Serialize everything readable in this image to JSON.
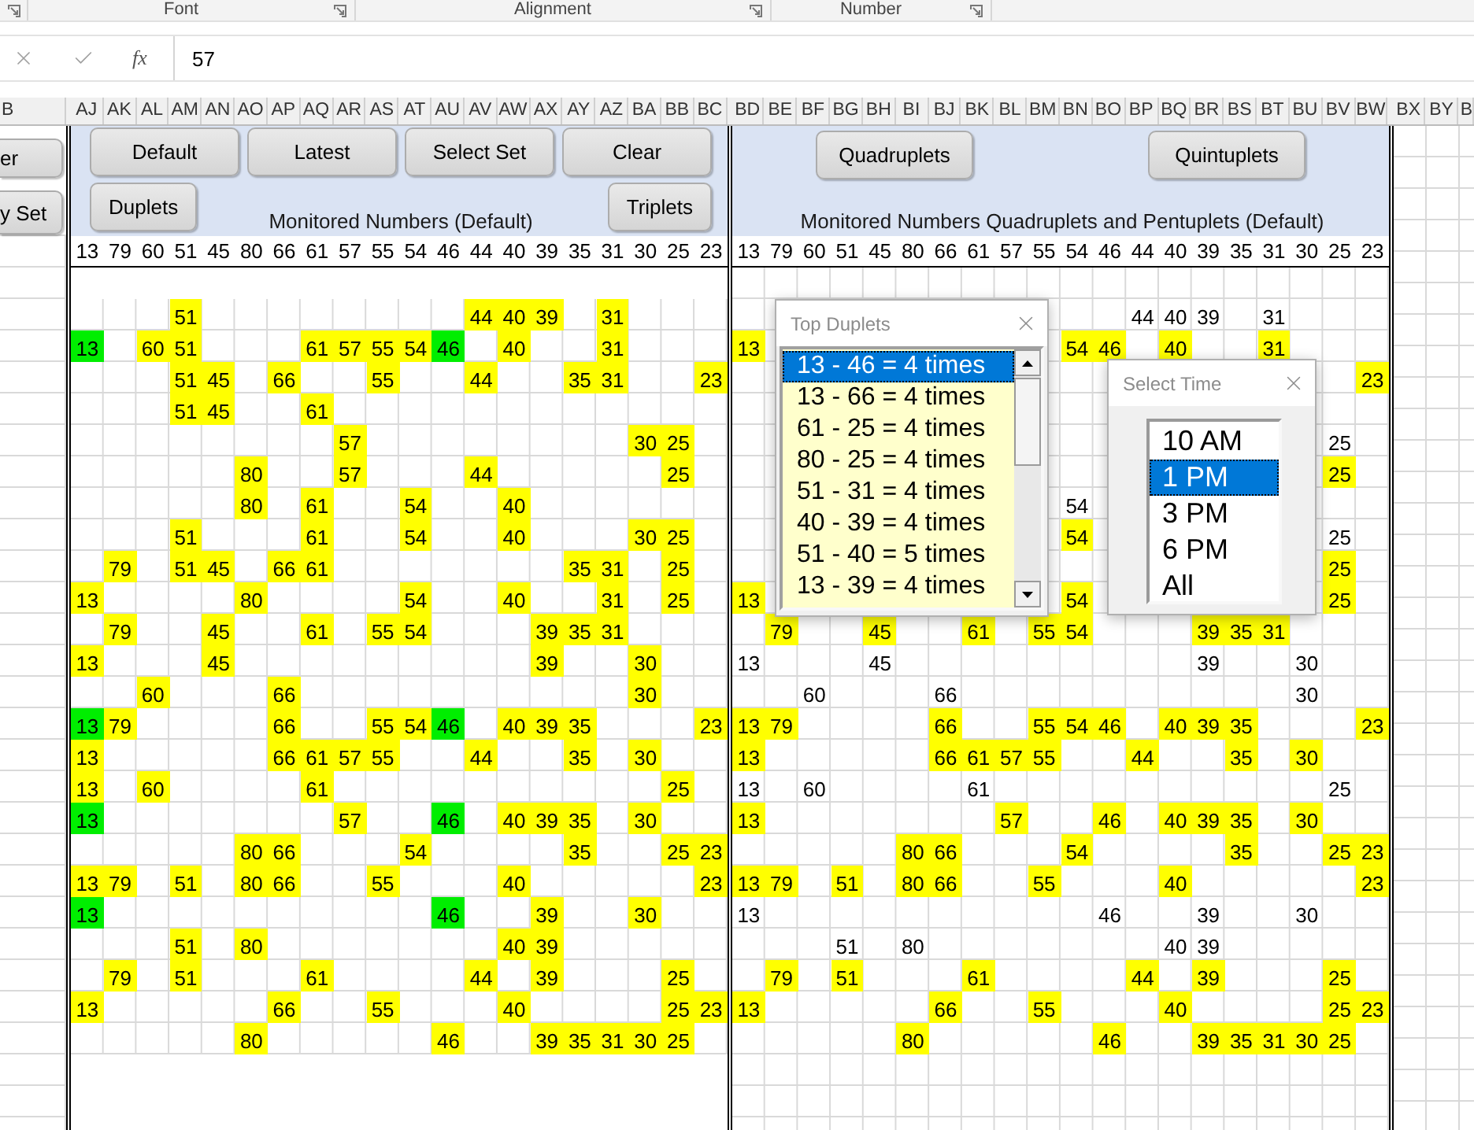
{
  "ribbon_groups": [
    {
      "label": "Font"
    },
    {
      "label": "Alignment"
    },
    {
      "label": "Number"
    }
  ],
  "formula_bar": {
    "function_label": "fx",
    "value": "57"
  },
  "column_headers": {
    "leading": "B",
    "panels": [
      [
        "AJ",
        "AK",
        "AL",
        "AM",
        "AN",
        "AO",
        "AP",
        "AQ",
        "AR",
        "AS",
        "AT",
        "AU",
        "AV",
        "AW",
        "AX",
        "AY",
        "AZ",
        "BA",
        "BB",
        "BC"
      ],
      [
        "BD",
        "BE",
        "BF",
        "BG",
        "BH",
        "BI",
        "BJ",
        "BK",
        "BL",
        "BM",
        "BN",
        "BO",
        "BP",
        "BQ",
        "BR",
        "BS",
        "BT",
        "BU",
        "BV",
        "BW"
      ]
    ],
    "trailing": [
      "BX",
      "BY",
      "B"
    ]
  },
  "side_buttons": [
    "er",
    "y Set"
  ],
  "panels": [
    {
      "top_buttons": [
        "Default",
        "Latest",
        "Select Set",
        "Clear"
      ],
      "bottom_left_buttons": [
        "Duplets"
      ],
      "bottom_right_buttons": [
        "Triplets"
      ],
      "title": "Monitored Numbers (Default)",
      "numbers": [
        "13",
        "79",
        "60",
        "51",
        "45",
        "80",
        "66",
        "61",
        "57",
        "55",
        "54",
        "46",
        "44",
        "40",
        "39",
        "35",
        "31",
        "30",
        "25",
        "23"
      ],
      "rows": [
        [
          null,
          null,
          null,
          {
            "text": "51",
            "color": "#ffff00"
          },
          null,
          null,
          null,
          null,
          null,
          null,
          null,
          null,
          {
            "text": "44",
            "color": "#ffff00"
          },
          {
            "text": "40",
            "color": "#ffff00"
          },
          {
            "text": "39",
            "color": "#ffff00"
          },
          null,
          {
            "text": "31",
            "color": "#ffff00"
          },
          null,
          null,
          null
        ],
        [
          {
            "text": "13",
            "color": "#00ee00"
          },
          null,
          {
            "text": "60",
            "color": "#ffff00"
          },
          {
            "text": "51",
            "color": "#ffff00"
          },
          null,
          null,
          null,
          {
            "text": "61",
            "color": "#ffff00"
          },
          {
            "text": "57",
            "color": "#ffff00"
          },
          {
            "text": "55",
            "color": "#ffff00"
          },
          {
            "text": "54",
            "color": "#ffff00"
          },
          {
            "text": "46",
            "color": "#00ee00"
          },
          null,
          {
            "text": "40",
            "color": "#ffff00"
          },
          null,
          null,
          {
            "text": "31",
            "color": "#ffff00"
          },
          null,
          null,
          null
        ],
        [
          null,
          null,
          null,
          {
            "text": "51",
            "color": "#ffff00"
          },
          {
            "text": "45",
            "color": "#ffff00"
          },
          null,
          {
            "text": "66",
            "color": "#ffff00"
          },
          null,
          null,
          {
            "text": "55",
            "color": "#ffff00"
          },
          null,
          null,
          {
            "text": "44",
            "color": "#ffff00"
          },
          null,
          null,
          {
            "text": "35",
            "color": "#ffff00"
          },
          {
            "text": "31",
            "color": "#ffff00"
          },
          null,
          null,
          {
            "text": "23",
            "color": "#ffff00"
          }
        ],
        [
          null,
          null,
          null,
          {
            "text": "51",
            "color": "#ffff00"
          },
          {
            "text": "45",
            "color": "#ffff00"
          },
          null,
          null,
          {
            "text": "61",
            "color": "#ffff00"
          },
          null,
          null,
          null,
          null,
          null,
          null,
          null,
          null,
          null,
          null,
          null,
          null
        ],
        [
          null,
          null,
          null,
          null,
          null,
          null,
          null,
          null,
          {
            "text": "57",
            "color": "#ffff00"
          },
          null,
          null,
          null,
          null,
          null,
          null,
          null,
          null,
          {
            "text": "30",
            "color": "#ffff00"
          },
          {
            "text": "25",
            "color": "#ffff00"
          },
          null
        ],
        [
          null,
          null,
          null,
          null,
          null,
          {
            "text": "80",
            "color": "#ffff00"
          },
          null,
          null,
          {
            "text": "57",
            "color": "#ffff00"
          },
          null,
          null,
          null,
          {
            "text": "44",
            "color": "#ffff00"
          },
          null,
          null,
          null,
          null,
          null,
          {
            "text": "25",
            "color": "#ffff00"
          },
          null
        ],
        [
          null,
          null,
          null,
          null,
          null,
          {
            "text": "80",
            "color": "#ffff00"
          },
          null,
          {
            "text": "61",
            "color": "#ffff00"
          },
          null,
          null,
          {
            "text": "54",
            "color": "#ffff00"
          },
          null,
          null,
          {
            "text": "40",
            "color": "#ffff00"
          },
          null,
          null,
          null,
          null,
          null,
          null
        ],
        [
          null,
          null,
          null,
          {
            "text": "51",
            "color": "#ffff00"
          },
          null,
          null,
          null,
          {
            "text": "61",
            "color": "#ffff00"
          },
          null,
          null,
          {
            "text": "54",
            "color": "#ffff00"
          },
          null,
          null,
          {
            "text": "40",
            "color": "#ffff00"
          },
          null,
          null,
          null,
          {
            "text": "30",
            "color": "#ffff00"
          },
          {
            "text": "25",
            "color": "#ffff00"
          },
          null
        ],
        [
          null,
          {
            "text": "79",
            "color": "#ffff00"
          },
          null,
          {
            "text": "51",
            "color": "#ffff00"
          },
          {
            "text": "45",
            "color": "#ffff00"
          },
          null,
          {
            "text": "66",
            "color": "#ffff00"
          },
          {
            "text": "61",
            "color": "#ffff00"
          },
          null,
          null,
          null,
          null,
          null,
          null,
          null,
          {
            "text": "35",
            "color": "#ffff00"
          },
          {
            "text": "31",
            "color": "#ffff00"
          },
          null,
          {
            "text": "25",
            "color": "#ffff00"
          },
          null
        ],
        [
          {
            "text": "13",
            "color": "#ffff00"
          },
          null,
          null,
          null,
          null,
          {
            "text": "80",
            "color": "#ffff00"
          },
          null,
          null,
          null,
          null,
          {
            "text": "54",
            "color": "#ffff00"
          },
          null,
          null,
          {
            "text": "40",
            "color": "#ffff00"
          },
          null,
          null,
          {
            "text": "31",
            "color": "#ffff00"
          },
          null,
          {
            "text": "25",
            "color": "#ffff00"
          },
          null
        ],
        [
          null,
          {
            "text": "79",
            "color": "#ffff00"
          },
          null,
          null,
          {
            "text": "45",
            "color": "#ffff00"
          },
          null,
          null,
          {
            "text": "61",
            "color": "#ffff00"
          },
          null,
          {
            "text": "55",
            "color": "#ffff00"
          },
          {
            "text": "54",
            "color": "#ffff00"
          },
          null,
          null,
          null,
          {
            "text": "39",
            "color": "#ffff00"
          },
          {
            "text": "35",
            "color": "#ffff00"
          },
          {
            "text": "31",
            "color": "#ffff00"
          },
          null,
          null,
          null
        ],
        [
          {
            "text": "13",
            "color": "#ffff00"
          },
          null,
          null,
          null,
          {
            "text": "45",
            "color": "#ffff00"
          },
          null,
          null,
          null,
          null,
          null,
          null,
          null,
          null,
          null,
          {
            "text": "39",
            "color": "#ffff00"
          },
          null,
          null,
          {
            "text": "30",
            "color": "#ffff00"
          },
          null,
          null
        ],
        [
          null,
          null,
          {
            "text": "60",
            "color": "#ffff00"
          },
          null,
          null,
          null,
          {
            "text": "66",
            "color": "#ffff00"
          },
          null,
          null,
          null,
          null,
          null,
          null,
          null,
          null,
          null,
          null,
          {
            "text": "30",
            "color": "#ffff00"
          },
          null,
          null
        ],
        [
          {
            "text": "13",
            "color": "#00ee00"
          },
          {
            "text": "79",
            "color": "#ffff00"
          },
          null,
          null,
          null,
          null,
          {
            "text": "66",
            "color": "#ffff00"
          },
          null,
          null,
          {
            "text": "55",
            "color": "#ffff00"
          },
          {
            "text": "54",
            "color": "#ffff00"
          },
          {
            "text": "46",
            "color": "#00ee00"
          },
          null,
          {
            "text": "40",
            "color": "#ffff00"
          },
          {
            "text": "39",
            "color": "#ffff00"
          },
          {
            "text": "35",
            "color": "#ffff00"
          },
          null,
          null,
          null,
          {
            "text": "23",
            "color": "#ffff00"
          }
        ],
        [
          {
            "text": "13",
            "color": "#ffff00"
          },
          null,
          null,
          null,
          null,
          null,
          {
            "text": "66",
            "color": "#ffff00"
          },
          {
            "text": "61",
            "color": "#ffff00"
          },
          {
            "text": "57",
            "color": "#ffff00"
          },
          {
            "text": "55",
            "color": "#ffff00"
          },
          null,
          null,
          {
            "text": "44",
            "color": "#ffff00"
          },
          null,
          null,
          {
            "text": "35",
            "color": "#ffff00"
          },
          null,
          {
            "text": "30",
            "color": "#ffff00"
          },
          null,
          null
        ],
        [
          {
            "text": "13",
            "color": "#ffff00"
          },
          null,
          {
            "text": "60",
            "color": "#ffff00"
          },
          null,
          null,
          null,
          null,
          {
            "text": "61",
            "color": "#ffff00"
          },
          null,
          null,
          null,
          null,
          null,
          null,
          null,
          null,
          null,
          null,
          {
            "text": "25",
            "color": "#ffff00"
          },
          null
        ],
        [
          {
            "text": "13",
            "color": "#00ee00"
          },
          null,
          null,
          null,
          null,
          null,
          null,
          null,
          {
            "text": "57",
            "color": "#ffff00"
          },
          null,
          null,
          {
            "text": "46",
            "color": "#00ee00"
          },
          null,
          {
            "text": "40",
            "color": "#ffff00"
          },
          {
            "text": "39",
            "color": "#ffff00"
          },
          {
            "text": "35",
            "color": "#ffff00"
          },
          null,
          {
            "text": "30",
            "color": "#ffff00"
          },
          null,
          null
        ],
        [
          null,
          null,
          null,
          null,
          null,
          {
            "text": "80",
            "color": "#ffff00"
          },
          {
            "text": "66",
            "color": "#ffff00"
          },
          null,
          null,
          null,
          {
            "text": "54",
            "color": "#ffff00"
          },
          null,
          null,
          null,
          null,
          {
            "text": "35",
            "color": "#ffff00"
          },
          null,
          null,
          {
            "text": "25",
            "color": "#ffff00"
          },
          {
            "text": "23",
            "color": "#ffff00"
          }
        ],
        [
          {
            "text": "13",
            "color": "#ffff00"
          },
          {
            "text": "79",
            "color": "#ffff00"
          },
          null,
          {
            "text": "51",
            "color": "#ffff00"
          },
          null,
          {
            "text": "80",
            "color": "#ffff00"
          },
          {
            "text": "66",
            "color": "#ffff00"
          },
          null,
          null,
          {
            "text": "55",
            "color": "#ffff00"
          },
          null,
          null,
          null,
          {
            "text": "40",
            "color": "#ffff00"
          },
          null,
          null,
          null,
          null,
          null,
          {
            "text": "23",
            "color": "#ffff00"
          }
        ],
        [
          {
            "text": "13",
            "color": "#00ee00"
          },
          null,
          null,
          null,
          null,
          null,
          null,
          null,
          null,
          null,
          null,
          {
            "text": "46",
            "color": "#00ee00"
          },
          null,
          null,
          {
            "text": "39",
            "color": "#ffff00"
          },
          null,
          null,
          {
            "text": "30",
            "color": "#ffff00"
          },
          null,
          null
        ],
        [
          null,
          null,
          null,
          {
            "text": "51",
            "color": "#ffff00"
          },
          null,
          {
            "text": "80",
            "color": "#ffff00"
          },
          null,
          null,
          null,
          null,
          null,
          null,
          null,
          {
            "text": "40",
            "color": "#ffff00"
          },
          {
            "text": "39",
            "color": "#ffff00"
          },
          null,
          null,
          null,
          null,
          null
        ],
        [
          null,
          {
            "text": "79",
            "color": "#ffff00"
          },
          null,
          {
            "text": "51",
            "color": "#ffff00"
          },
          null,
          null,
          null,
          {
            "text": "61",
            "color": "#ffff00"
          },
          null,
          null,
          null,
          null,
          {
            "text": "44",
            "color": "#ffff00"
          },
          null,
          {
            "text": "39",
            "color": "#ffff00"
          },
          null,
          null,
          null,
          {
            "text": "25",
            "color": "#ffff00"
          },
          null
        ],
        [
          {
            "text": "13",
            "color": "#ffff00"
          },
          null,
          null,
          null,
          null,
          null,
          {
            "text": "66",
            "color": "#ffff00"
          },
          null,
          null,
          {
            "text": "55",
            "color": "#ffff00"
          },
          null,
          null,
          null,
          {
            "text": "40",
            "color": "#ffff00"
          },
          null,
          null,
          null,
          null,
          {
            "text": "25",
            "color": "#ffff00"
          },
          {
            "text": "23",
            "color": "#ffff00"
          }
        ],
        [
          null,
          null,
          null,
          null,
          null,
          {
            "text": "80",
            "color": "#ffff00"
          },
          null,
          null,
          null,
          null,
          null,
          {
            "text": "46",
            "color": "#ffff00"
          },
          null,
          null,
          {
            "text": "39",
            "color": "#ffff00"
          },
          {
            "text": "35",
            "color": "#ffff00"
          },
          {
            "text": "31",
            "color": "#ffff00"
          },
          {
            "text": "30",
            "color": "#ffff00"
          },
          {
            "text": "25",
            "color": "#ffff00"
          },
          null
        ]
      ]
    },
    {
      "top_buttons": [
        "Quadruplets",
        "Quintuplets"
      ],
      "title": "Monitored Numbers Quadruplets and Pentuplets (Default)",
      "numbers": [
        "13",
        "79",
        "60",
        "51",
        "45",
        "80",
        "66",
        "61",
        "57",
        "55",
        "54",
        "46",
        "44",
        "40",
        "39",
        "35",
        "31",
        "30",
        "25",
        "23"
      ],
      "rows": [
        [
          null,
          null,
          null,
          null,
          null,
          null,
          null,
          null,
          null,
          null,
          null,
          null,
          {
            "text": "44"
          },
          {
            "text": "40"
          },
          {
            "text": "39"
          },
          null,
          {
            "text": "31"
          },
          null,
          null,
          null
        ],
        [
          {
            "text": "13",
            "color": "#ffff00"
          },
          null,
          null,
          null,
          null,
          null,
          null,
          null,
          null,
          null,
          {
            "text": "54",
            "color": "#ffff00"
          },
          {
            "text": "46",
            "color": "#ffff00"
          },
          null,
          {
            "text": "40",
            "color": "#ffff00"
          },
          null,
          null,
          {
            "text": "31",
            "color": "#ffff00"
          },
          null,
          null,
          null
        ],
        [
          null,
          null,
          null,
          null,
          null,
          null,
          null,
          null,
          null,
          null,
          null,
          null,
          null,
          null,
          null,
          null,
          null,
          null,
          null,
          {
            "text": "23",
            "color": "#ffff00"
          }
        ],
        [
          null,
          null,
          null,
          null,
          null,
          null,
          null,
          null,
          null,
          null,
          null,
          null,
          null,
          null,
          null,
          null,
          null,
          null,
          null,
          null
        ],
        [
          null,
          null,
          null,
          null,
          null,
          null,
          null,
          null,
          null,
          null,
          null,
          null,
          null,
          null,
          null,
          null,
          null,
          null,
          {
            "text": "25"
          },
          null
        ],
        [
          null,
          null,
          null,
          null,
          null,
          null,
          null,
          null,
          null,
          null,
          null,
          null,
          null,
          null,
          null,
          null,
          null,
          null,
          {
            "text": "25",
            "color": "#ffff00"
          },
          null
        ],
        [
          null,
          null,
          null,
          null,
          null,
          null,
          null,
          null,
          null,
          null,
          {
            "text": "54"
          },
          null,
          null,
          null,
          null,
          null,
          null,
          null,
          null,
          null
        ],
        [
          null,
          null,
          null,
          null,
          null,
          null,
          null,
          null,
          null,
          null,
          {
            "text": "54",
            "color": "#ffff00"
          },
          null,
          null,
          null,
          null,
          null,
          null,
          null,
          {
            "text": "25"
          },
          null
        ],
        [
          null,
          null,
          null,
          null,
          null,
          null,
          null,
          null,
          null,
          null,
          null,
          null,
          null,
          null,
          null,
          null,
          null,
          null,
          {
            "text": "25",
            "color": "#ffff00"
          },
          null
        ],
        [
          {
            "text": "13",
            "color": "#ffff00"
          },
          null,
          null,
          null,
          null,
          null,
          null,
          null,
          null,
          null,
          {
            "text": "54",
            "color": "#ffff00"
          },
          null,
          null,
          null,
          null,
          null,
          null,
          null,
          {
            "text": "25",
            "color": "#ffff00"
          },
          null
        ],
        [
          null,
          {
            "text": "79",
            "color": "#ffff00"
          },
          null,
          null,
          {
            "text": "45",
            "color": "#ffff00"
          },
          null,
          null,
          {
            "text": "61",
            "color": "#ffff00"
          },
          null,
          {
            "text": "55",
            "color": "#ffff00"
          },
          {
            "text": "54",
            "color": "#ffff00"
          },
          null,
          null,
          null,
          {
            "text": "39",
            "color": "#ffff00"
          },
          {
            "text": "35",
            "color": "#ffff00"
          },
          {
            "text": "31",
            "color": "#ffff00"
          },
          null,
          null,
          null
        ],
        [
          {
            "text": "13"
          },
          null,
          null,
          null,
          {
            "text": "45"
          },
          null,
          null,
          null,
          null,
          null,
          null,
          null,
          null,
          null,
          {
            "text": "39"
          },
          null,
          null,
          {
            "text": "30"
          },
          null,
          null
        ],
        [
          null,
          null,
          {
            "text": "60"
          },
          null,
          null,
          null,
          {
            "text": "66"
          },
          null,
          null,
          null,
          null,
          null,
          null,
          null,
          null,
          null,
          null,
          {
            "text": "30"
          },
          null,
          null
        ],
        [
          {
            "text": "13",
            "color": "#ffff00"
          },
          {
            "text": "79",
            "color": "#ffff00"
          },
          null,
          null,
          null,
          null,
          {
            "text": "66",
            "color": "#ffff00"
          },
          null,
          null,
          {
            "text": "55",
            "color": "#ffff00"
          },
          {
            "text": "54",
            "color": "#ffff00"
          },
          {
            "text": "46",
            "color": "#ffff00"
          },
          null,
          {
            "text": "40",
            "color": "#ffff00"
          },
          {
            "text": "39",
            "color": "#ffff00"
          },
          {
            "text": "35",
            "color": "#ffff00"
          },
          null,
          null,
          null,
          {
            "text": "23",
            "color": "#ffff00"
          }
        ],
        [
          {
            "text": "13",
            "color": "#ffff00"
          },
          null,
          null,
          null,
          null,
          null,
          {
            "text": "66",
            "color": "#ffff00"
          },
          {
            "text": "61",
            "color": "#ffff00"
          },
          {
            "text": "57",
            "color": "#ffff00"
          },
          {
            "text": "55",
            "color": "#ffff00"
          },
          null,
          null,
          {
            "text": "44",
            "color": "#ffff00"
          },
          null,
          null,
          {
            "text": "35",
            "color": "#ffff00"
          },
          null,
          {
            "text": "30",
            "color": "#ffff00"
          },
          null,
          null
        ],
        [
          {
            "text": "13"
          },
          null,
          {
            "text": "60"
          },
          null,
          null,
          null,
          null,
          {
            "text": "61"
          },
          null,
          null,
          null,
          null,
          null,
          null,
          null,
          null,
          null,
          null,
          {
            "text": "25"
          },
          null
        ],
        [
          {
            "text": "13",
            "color": "#ffff00"
          },
          null,
          null,
          null,
          null,
          null,
          null,
          null,
          {
            "text": "57",
            "color": "#ffff00"
          },
          null,
          null,
          {
            "text": "46",
            "color": "#ffff00"
          },
          null,
          {
            "text": "40",
            "color": "#ffff00"
          },
          {
            "text": "39",
            "color": "#ffff00"
          },
          {
            "text": "35",
            "color": "#ffff00"
          },
          null,
          {
            "text": "30",
            "color": "#ffff00"
          },
          null,
          null
        ],
        [
          null,
          null,
          null,
          null,
          null,
          {
            "text": "80",
            "color": "#ffff00"
          },
          {
            "text": "66",
            "color": "#ffff00"
          },
          null,
          null,
          null,
          {
            "text": "54",
            "color": "#ffff00"
          },
          null,
          null,
          null,
          null,
          {
            "text": "35",
            "color": "#ffff00"
          },
          null,
          null,
          {
            "text": "25",
            "color": "#ffff00"
          },
          {
            "text": "23",
            "color": "#ffff00"
          }
        ],
        [
          {
            "text": "13",
            "color": "#ffff00"
          },
          {
            "text": "79",
            "color": "#ffff00"
          },
          null,
          {
            "text": "51",
            "color": "#ffff00"
          },
          null,
          {
            "text": "80",
            "color": "#ffff00"
          },
          {
            "text": "66",
            "color": "#ffff00"
          },
          null,
          null,
          {
            "text": "55",
            "color": "#ffff00"
          },
          null,
          null,
          null,
          {
            "text": "40",
            "color": "#ffff00"
          },
          null,
          null,
          null,
          null,
          null,
          {
            "text": "23",
            "color": "#ffff00"
          }
        ],
        [
          {
            "text": "13"
          },
          null,
          null,
          null,
          null,
          null,
          null,
          null,
          null,
          null,
          null,
          {
            "text": "46"
          },
          null,
          null,
          {
            "text": "39"
          },
          null,
          null,
          {
            "text": "30"
          },
          null,
          null
        ],
        [
          null,
          null,
          null,
          {
            "text": "51"
          },
          null,
          {
            "text": "80"
          },
          null,
          null,
          null,
          null,
          null,
          null,
          null,
          {
            "text": "40"
          },
          {
            "text": "39"
          },
          null,
          null,
          null,
          null,
          null
        ],
        [
          null,
          {
            "text": "79",
            "color": "#ffff00"
          },
          null,
          {
            "text": "51",
            "color": "#ffff00"
          },
          null,
          null,
          null,
          {
            "text": "61",
            "color": "#ffff00"
          },
          null,
          null,
          null,
          null,
          {
            "text": "44",
            "color": "#ffff00"
          },
          null,
          {
            "text": "39",
            "color": "#ffff00"
          },
          null,
          null,
          null,
          {
            "text": "25",
            "color": "#ffff00"
          },
          null
        ],
        [
          {
            "text": "13",
            "color": "#ffff00"
          },
          null,
          null,
          null,
          null,
          null,
          {
            "text": "66",
            "color": "#ffff00"
          },
          null,
          null,
          {
            "text": "55",
            "color": "#ffff00"
          },
          null,
          null,
          null,
          {
            "text": "40",
            "color": "#ffff00"
          },
          null,
          null,
          null,
          null,
          {
            "text": "25",
            "color": "#ffff00"
          },
          {
            "text": "23",
            "color": "#ffff00"
          }
        ],
        [
          null,
          null,
          null,
          null,
          null,
          {
            "text": "80",
            "color": "#ffff00"
          },
          null,
          null,
          null,
          null,
          null,
          {
            "text": "46",
            "color": "#ffff00"
          },
          null,
          null,
          {
            "text": "39",
            "color": "#ffff00"
          },
          {
            "text": "35",
            "color": "#ffff00"
          },
          {
            "text": "31",
            "color": "#ffff00"
          },
          {
            "text": "30",
            "color": "#ffff00"
          },
          {
            "text": "25",
            "color": "#ffff00"
          },
          null
        ]
      ]
    }
  ],
  "duplets_dialog": {
    "title": "Top Duplets",
    "items": [
      {
        "text": "13 - 46 = 4 times",
        "selected": true
      },
      {
        "text": "13 - 66 = 4 times",
        "selected": false
      },
      {
        "text": "61 - 25 = 4 times",
        "selected": false
      },
      {
        "text": "80 - 25 = 4 times",
        "selected": false
      },
      {
        "text": "51 - 31 = 4 times",
        "selected": false
      },
      {
        "text": "40 - 39 = 4 times",
        "selected": false
      },
      {
        "text": "51 - 40 = 5 times",
        "selected": false
      },
      {
        "text": "13 - 39 = 4 times",
        "selected": false
      }
    ]
  },
  "time_dialog": {
    "title": "Select Time",
    "items": [
      {
        "text": "10 AM",
        "selected": false
      },
      {
        "text": "1 PM",
        "selected": true
      },
      {
        "text": "3 PM",
        "selected": false
      },
      {
        "text": "6 PM",
        "selected": false
      },
      {
        "text": "All",
        "selected": false
      }
    ]
  }
}
